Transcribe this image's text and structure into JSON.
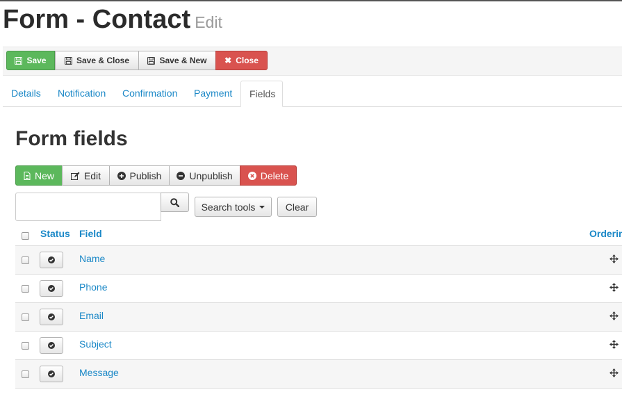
{
  "page": {
    "title": "Form - Contact",
    "subtitle": "Edit"
  },
  "toolbar": {
    "save": "Save",
    "save_close": "Save & Close",
    "save_new": "Save & New",
    "close": "Close"
  },
  "tabs": [
    {
      "label": "Details"
    },
    {
      "label": "Notification"
    },
    {
      "label": "Confirmation"
    },
    {
      "label": "Payment"
    },
    {
      "label": "Fields",
      "active": true
    }
  ],
  "section": {
    "title": "Form fields"
  },
  "actions": {
    "new": "New",
    "edit": "Edit",
    "publish": "Publish",
    "unpublish": "Unpublish",
    "delete": "Delete"
  },
  "filter": {
    "search_value": "",
    "search_tools": "Search tools",
    "clear": "Clear"
  },
  "table": {
    "headers": {
      "status": "Status",
      "field": "Field",
      "ordering": "Orderin"
    },
    "rows": [
      {
        "field": "Name",
        "published": true
      },
      {
        "field": "Phone",
        "published": true
      },
      {
        "field": "Email",
        "published": true
      },
      {
        "field": "Subject",
        "published": true
      },
      {
        "field": "Message",
        "published": true
      }
    ]
  },
  "colors": {
    "link": "#1b88c7",
    "success": "#5cb85c",
    "danger": "#d9534f"
  },
  "icons": {
    "save": "floppy-disk-icon",
    "close": "x-icon",
    "new": "document-icon",
    "edit": "pencil-square-icon",
    "publish": "plus-circle-icon",
    "unpublish": "minus-circle-icon",
    "delete": "x-circle-icon",
    "search": "search-icon",
    "status": "check-circle-icon",
    "ordering": "move-icon"
  }
}
